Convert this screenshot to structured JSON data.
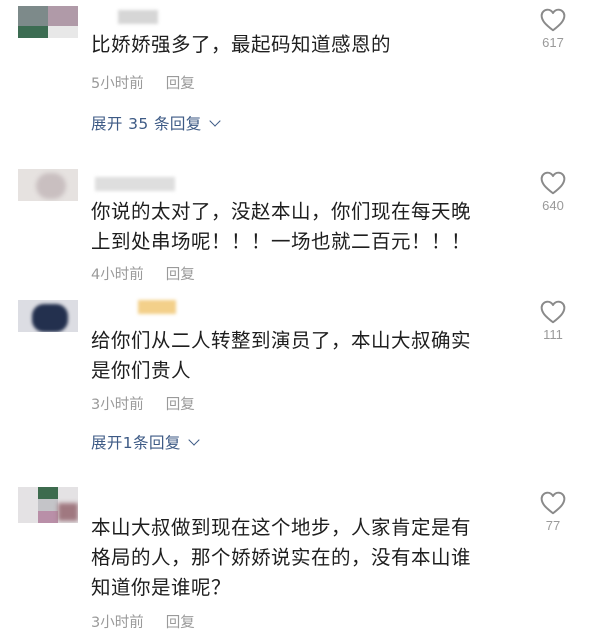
{
  "comments": [
    {
      "text": "比娇娇强多了，最起码知道感恩的",
      "time": "5小时前",
      "reply": "回复",
      "likes": "617",
      "expand": "展开 35 条回复"
    },
    {
      "text_lines": [
        "你说的太对了，没赵本山，你们现在每天晚",
        "上到处串场呢！！！一场也就二百元！！！"
      ],
      "time": "4小时前",
      "reply": "回复",
      "likes": "640"
    },
    {
      "text_lines": [
        "给你们从二人转整到演员了，本山大叔确实",
        "是你们贵人"
      ],
      "time": "3小时前",
      "reply": "回复",
      "likes": "111",
      "expand": "展开1条回复"
    },
    {
      "text_lines": [
        "本山大叔做到现在这个地步，人家肯定是有",
        "格局的人，那个娇娇说实在的，没有本山谁",
        "知道你是谁呢？"
      ],
      "time": "3小时前",
      "reply": "回复",
      "likes": "77"
    }
  ],
  "icons": {
    "like": "heart-outline-icon"
  },
  "colors": {
    "link": "#3d5a85",
    "meta": "#9a9a9a"
  }
}
